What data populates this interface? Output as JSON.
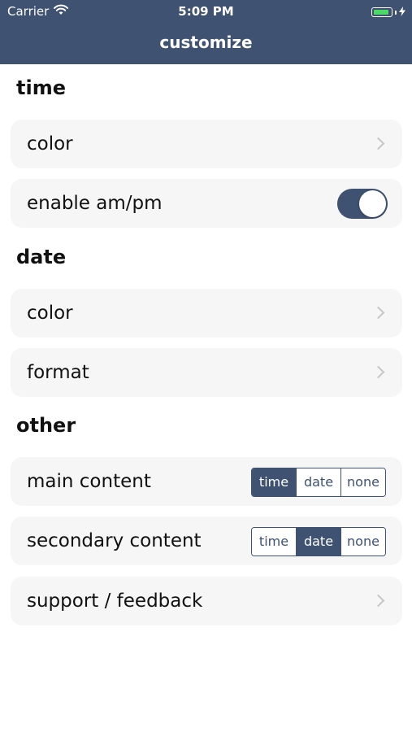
{
  "status_bar": {
    "carrier": "Carrier",
    "time": "5:09 PM",
    "wifi_icon": "wifi-icon",
    "battery_icon": "battery-icon",
    "charging_icon": "bolt-icon"
  },
  "nav": {
    "title": "customize"
  },
  "sections": {
    "time": {
      "title": "time",
      "color_label": "color",
      "ampm_label": "enable am/pm",
      "ampm_enabled": true
    },
    "date": {
      "title": "date",
      "color_label": "color",
      "format_label": "format"
    },
    "other": {
      "title": "other",
      "main_content_label": "main content",
      "main_content_options": [
        "time",
        "date",
        "none"
      ],
      "main_content_selected": "time",
      "secondary_content_label": "secondary content",
      "secondary_content_options": [
        "time",
        "date",
        "none"
      ],
      "secondary_content_selected": "date",
      "support_label": "support / feedback"
    }
  },
  "colors": {
    "accent": "#3f5271",
    "row_background": "#f6f6f7",
    "battery_green": "#4cd964"
  }
}
